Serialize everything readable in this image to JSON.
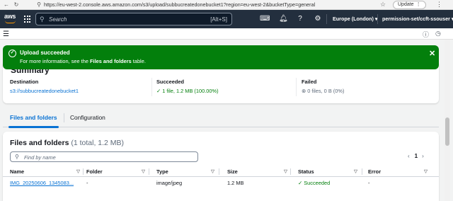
{
  "browser": {
    "url": "https://eu-west-2.console.aws.amazon.com/s3/upload/subbucreatedonebucket1?region=eu-west-2&bucketType=general",
    "update_label": "Update"
  },
  "topnav": {
    "logo_text": "aws",
    "search_placeholder": "Search",
    "search_shortcut": "[Alt+S]",
    "region": "Europe (London) ▾",
    "account": "permission-set/ccft-ssouser ▾"
  },
  "flash": {
    "title": "Upload succeeded",
    "message_prefix": "For more information, see the ",
    "message_bold": "Files and folders",
    "message_suffix": " table.",
    "close": "✕",
    "color": "#037f0c"
  },
  "summary": {
    "title": "Summary",
    "destination_label": "Destination",
    "destination_value": "s3://subbucreatedonebucket1",
    "succeeded_label": "Succeeded",
    "succeeded_value": "1 file, 1.2 MB (100.00%)",
    "failed_label": "Failed",
    "failed_value": "0 files, 0 B (0%)"
  },
  "tabs": [
    {
      "label": "Files and folders",
      "active": true
    },
    {
      "label": "Configuration",
      "active": false
    }
  ],
  "files": {
    "title": "Files and folders",
    "count": "(1 total, 1.2 MB)",
    "search_placeholder": "Find by name",
    "page": "1",
    "columns": [
      "Name",
      "Folder",
      "Type",
      "Size",
      "Status",
      "Error"
    ],
    "rows": [
      {
        "name": "IMG_20250606_1345083...",
        "folder": "-",
        "type": "image/jpeg",
        "size": "1.2 MB",
        "status": "Succeeded",
        "error": "-"
      }
    ]
  },
  "colors": {
    "nav_bg": "#232f3e",
    "link": "#0972d3",
    "success": "#037f0c"
  }
}
